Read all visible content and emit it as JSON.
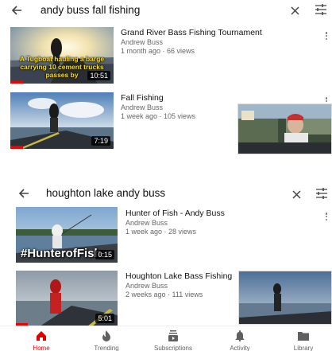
{
  "colors": {
    "accent": "#e00000",
    "text": "#111111",
    "meta": "#666666"
  },
  "search1": {
    "query": "andy buss fall fishing"
  },
  "search2": {
    "query": "houghton lake andy buss"
  },
  "results1": [
    {
      "title": "Grand River Bass Fishing Tournament",
      "channel": "Andrew Buss",
      "stats": "1 month ago · 66 views",
      "duration": "10:51",
      "overlay": "A Tugboat hauling a barge carrying 10 cement trucks passes by",
      "watched": 0.12
    },
    {
      "title": "Fall Fishing",
      "channel": "Andrew Buss",
      "stats": "1 week ago · 105 views",
      "duration": "7:19",
      "watched": 0.12
    }
  ],
  "results2": [
    {
      "title": "Hunter of Fish  - Andy Buss",
      "channel": "Andrew Buss",
      "stats": "1 week ago · 28 views",
      "duration": "0:15",
      "overlay": "#HunterofFish"
    },
    {
      "title": "Houghton Lake Bass Fishing",
      "channel": "Andrew Buss",
      "stats": "2 weeks ago · 111 views",
      "duration": "5:01",
      "watched": 0.12
    }
  ],
  "nav": [
    {
      "label": "Home",
      "icon": "home-icon",
      "active": true
    },
    {
      "label": "Trending",
      "icon": "flame-icon"
    },
    {
      "label": "Subscriptions",
      "icon": "subscriptions-icon"
    },
    {
      "label": "Activity",
      "icon": "bell-icon"
    },
    {
      "label": "Library",
      "icon": "folder-icon"
    }
  ]
}
